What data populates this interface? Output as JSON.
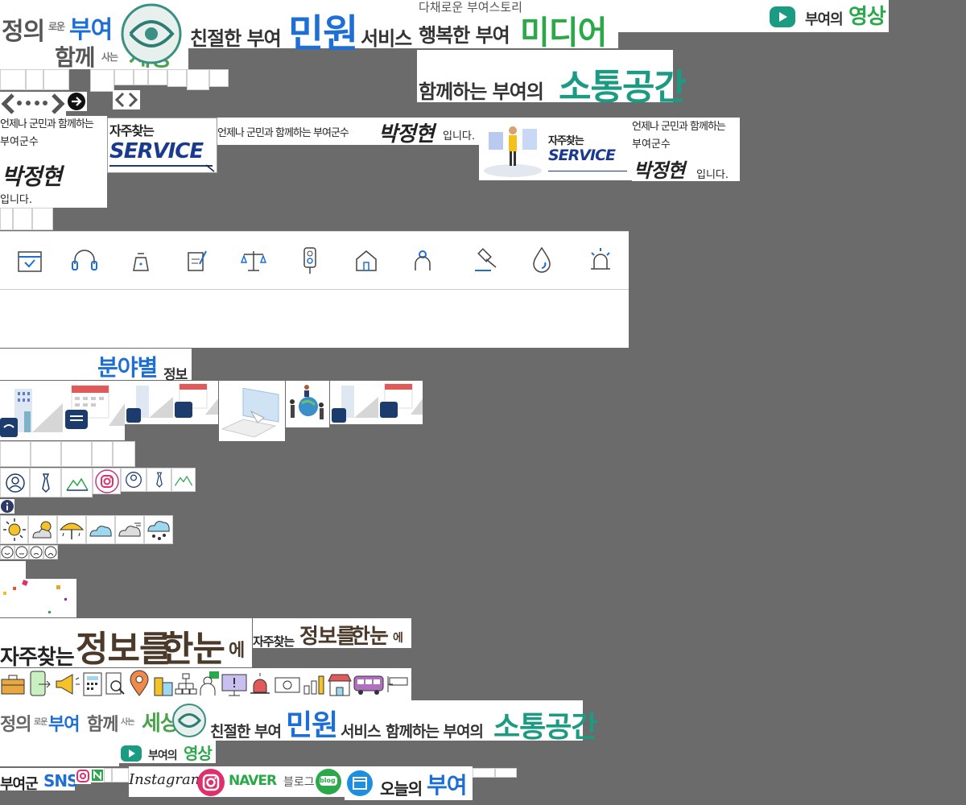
{
  "banners": {
    "b1": {
      "a": "정의",
      "b": "로운",
      "c": "부여",
      "d": "함께",
      "e": "사는",
      "f": "세상"
    },
    "b2": {
      "a": "친절한 부여",
      "b": "민원",
      "c": "서비스"
    },
    "b3": {
      "a": "다채로운 부여스토리",
      "b": "행복한 부여",
      "c": "미디어"
    },
    "b4": {
      "a": "부여의",
      "b": "영상"
    },
    "b5": {
      "a": "함께하는 부여의",
      "b": "소통공간"
    }
  },
  "slogan": {
    "line1": "언제나 군민과 함께하는",
    "line2": "부여군수",
    "name": "박정현",
    "suffix": "입니다.",
    "inline": "언제나 군민과 함께하는 부여군수"
  },
  "service": {
    "a": "자주찾는",
    "b": "SERVICE"
  },
  "field_info": {
    "a": "분야별",
    "b": "정보"
  },
  "freq_info": {
    "a": "자주찾는",
    "b": "정보를",
    "c": "한눈",
    "d": "에"
  },
  "footer": {
    "b1": {
      "a": "정의",
      "b": "로운",
      "c": "부여",
      "d": "함께",
      "e": "사는",
      "f": "세상"
    },
    "b2": {
      "a": "친절한 부여",
      "b": "민원",
      "c": "서비스"
    },
    "b3": {
      "a": "함께하는 부여의",
      "b": "소통공간"
    },
    "b4": {
      "a": "부여의",
      "b": "영상"
    }
  },
  "sns": {
    "a": "부여군",
    "b": "SNS",
    "instagram": "Instagram",
    "naver": "NAVER",
    "blog_label": "블로그",
    "blog_badge": "blog",
    "today_a": "오늘의",
    "today_b": "부여"
  },
  "colors": {
    "accent_blue": "#1d6fd6",
    "green": "#2aa84a",
    "teal": "#1a9b82",
    "navy": "#1a3a8f",
    "brand_pink": "#e0306b"
  }
}
